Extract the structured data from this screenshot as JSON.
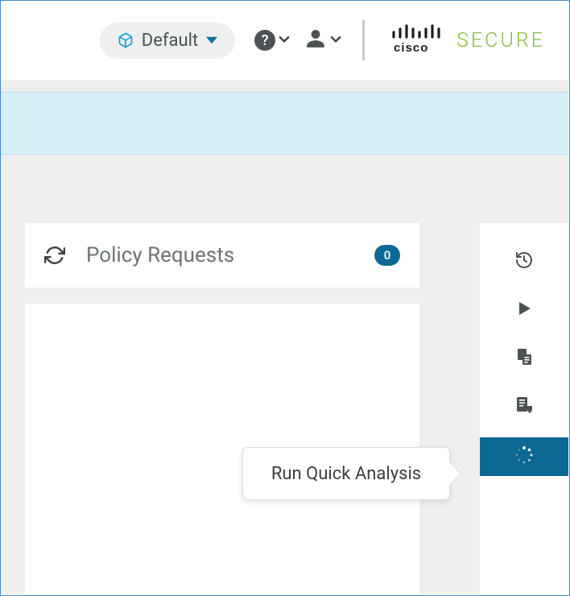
{
  "header": {
    "scope_label": "Default",
    "brand_secure": "SECURE"
  },
  "policy_card": {
    "title": "Policy Requests",
    "count": "0"
  },
  "tooltip": {
    "run_quick_analysis": "Run Quick Analysis"
  },
  "colors": {
    "accent_teal": "#0d6994",
    "cisco_green": "#88bd3f",
    "light_blue_band": "#d8f0fa"
  }
}
